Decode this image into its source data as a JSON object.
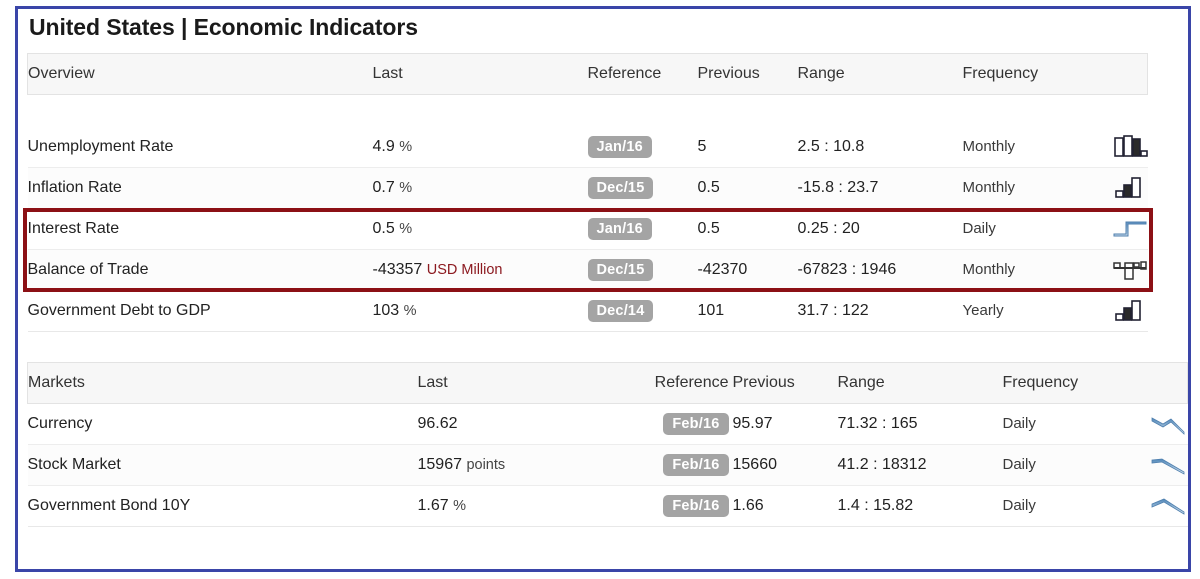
{
  "page": {
    "title": "United States | Economic Indicators",
    "frame_color": "#3a45a8",
    "highlight_color": "#8c1015",
    "negative_color": "#8c1a20",
    "badge_color": "#a4a4a4"
  },
  "overview": {
    "headers": {
      "name": "Overview",
      "last": "Last",
      "reference": "Reference",
      "previous": "Previous",
      "range": "Range",
      "frequency": "Frequency"
    },
    "rows": [
      {
        "name": "Unemployment Rate",
        "last": "4.9",
        "unit": "%",
        "reference": "Jan/16",
        "previous": "5",
        "range": "2.5 : 10.8",
        "frequency": "Monthly",
        "negative": false,
        "icon": "bar-chart-icon",
        "highlighted": false
      },
      {
        "name": "Inflation Rate",
        "last": "0.7",
        "unit": "%",
        "reference": "Dec/15",
        "previous": "0.5",
        "range": "-15.8 : 23.7",
        "frequency": "Monthly",
        "negative": false,
        "range_negative": true,
        "icon": "bar-chart-rising-icon",
        "highlighted": false
      },
      {
        "name": "Interest Rate",
        "last": "0.5",
        "unit": "%",
        "reference": "Jan/16",
        "previous": "0.5",
        "range": "0.25 : 20",
        "frequency": "Daily",
        "negative": false,
        "icon": "step-line-icon",
        "highlighted": true
      },
      {
        "name": "Balance of Trade",
        "last": "-43357",
        "unit": "USD Million",
        "reference": "Dec/15",
        "previous": "-42370",
        "range": "-67823 : 1946",
        "frequency": "Monthly",
        "negative": true,
        "range_negative": true,
        "icon": "negative-bar-chart-icon",
        "highlighted": true
      },
      {
        "name": "Government Debt to GDP",
        "last": "103",
        "unit": "%",
        "reference": "Dec/14",
        "previous": "101",
        "range": "31.7 : 122",
        "frequency": "Yearly",
        "negative": false,
        "icon": "bar-chart-rising-icon",
        "highlighted": false
      }
    ]
  },
  "markets": {
    "headers": {
      "name": "Markets",
      "last": "Last",
      "reference": "Reference",
      "previous": "Previous",
      "range": "Range",
      "frequency": "Frequency"
    },
    "rows": [
      {
        "name": "Currency",
        "last": "96.62",
        "unit": "",
        "reference": "Feb/16",
        "previous": "95.97",
        "range": "71.32 : 165",
        "frequency": "Daily",
        "icon": "sparkline-down-icon"
      },
      {
        "name": "Stock Market",
        "last": "15967",
        "unit": "points",
        "reference": "Feb/16",
        "previous": "15660",
        "range": "41.2 : 18312",
        "frequency": "Daily",
        "icon": "sparkline-decline-icon"
      },
      {
        "name": "Government Bond 10Y",
        "last": "1.67",
        "unit": "%",
        "reference": "Feb/16",
        "previous": "1.66",
        "range": "1.4 : 15.82",
        "frequency": "Daily",
        "icon": "sparkline-arch-icon"
      }
    ]
  }
}
